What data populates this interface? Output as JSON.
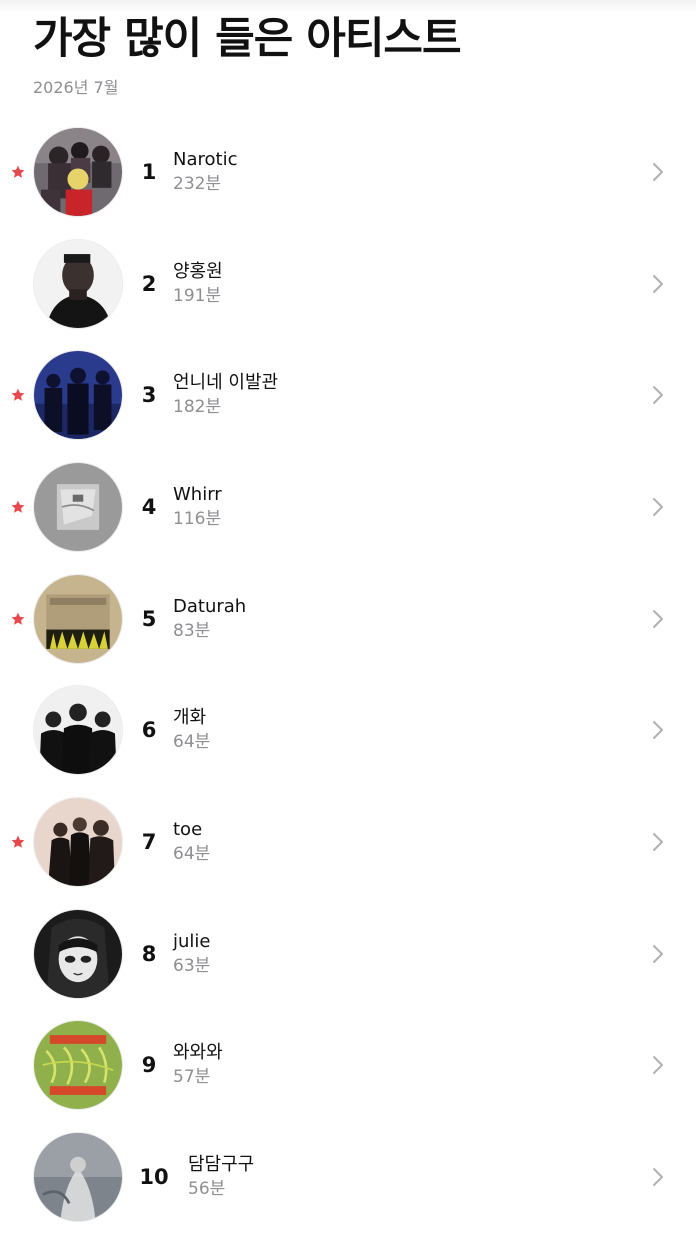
{
  "header": {
    "title": "가장 많이 들은 아티스트",
    "subtitle": "2026년 7월"
  },
  "colors": {
    "accent_star": "#e5484d",
    "secondary_text": "#8e8e93",
    "chevron": "#b0b0b5"
  },
  "icons": {
    "favorite": "star-icon",
    "disclosure": "chevron-right-icon"
  },
  "artists": [
    {
      "rank": "1",
      "name": "Narotic",
      "minutes": "232분",
      "favorite": true
    },
    {
      "rank": "2",
      "name": "양홍원",
      "minutes": "191분",
      "favorite": false
    },
    {
      "rank": "3",
      "name": "언니네 이발관",
      "minutes": "182분",
      "favorite": true
    },
    {
      "rank": "4",
      "name": "Whirr",
      "minutes": "116분",
      "favorite": true
    },
    {
      "rank": "5",
      "name": "Daturah",
      "minutes": "83분",
      "favorite": true
    },
    {
      "rank": "6",
      "name": "개화",
      "minutes": "64분",
      "favorite": false
    },
    {
      "rank": "7",
      "name": "toe",
      "minutes": "64분",
      "favorite": true
    },
    {
      "rank": "8",
      "name": "julie",
      "minutes": "63분",
      "favorite": false
    },
    {
      "rank": "9",
      "name": "와와와",
      "minutes": "57분",
      "favorite": false
    },
    {
      "rank": "10",
      "name": "담담구구",
      "minutes": "56분",
      "favorite": false
    }
  ]
}
